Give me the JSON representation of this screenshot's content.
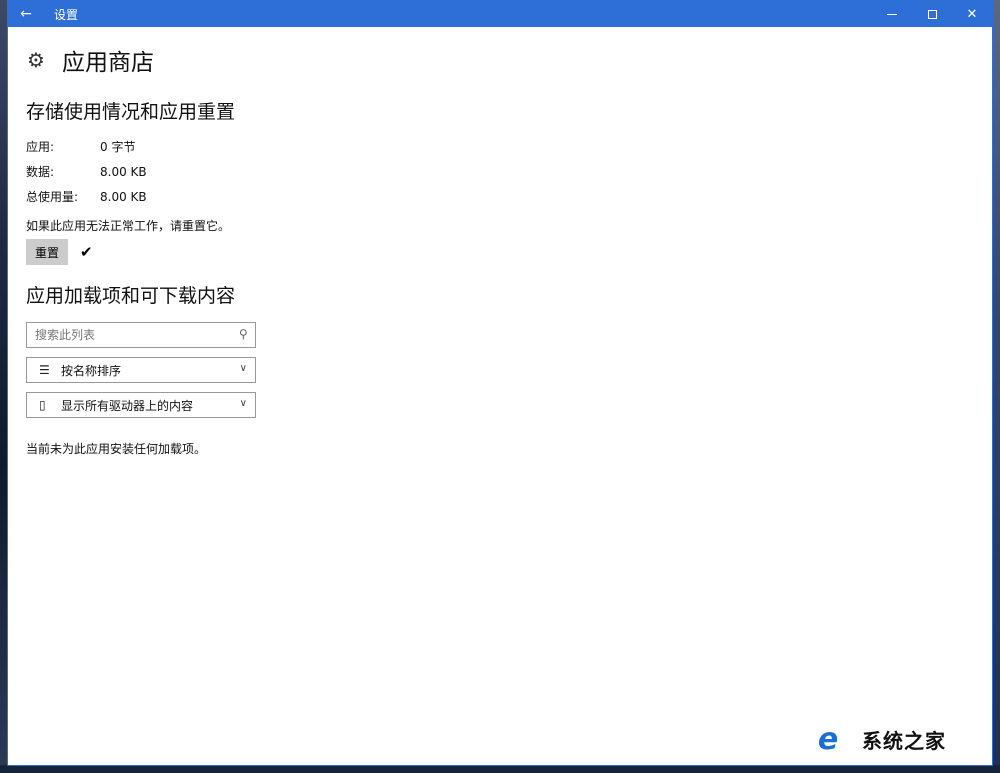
{
  "window": {
    "title": "设置",
    "back_icon": "←",
    "controls": {
      "close_icon": "✕"
    }
  },
  "page": {
    "icon": "⚙",
    "title": "应用商店"
  },
  "storage": {
    "title": "存储使用情况和应用重置",
    "rows": [
      {
        "label": "应用:",
        "value": "0 字节"
      },
      {
        "label": "数据:",
        "value": "8.00 KB"
      },
      {
        "label": "总使用量:",
        "value": "8.00 KB"
      }
    ],
    "reset_hint": "如果此应用无法正常工作，请重置它。",
    "reset_button": "重置",
    "reset_done_icon": "✔"
  },
  "addons": {
    "title": "应用加载项和可下载内容",
    "search": {
      "placeholder": "搜索此列表",
      "value": ""
    },
    "sort_dropdown": {
      "icon": "☰",
      "selected": "按名称排序"
    },
    "drive_dropdown": {
      "icon": "▯",
      "selected": "显示所有驱动器上的内容"
    },
    "chevron_icon": "∨",
    "empty_message": "当前未为此应用安装任何加载项。"
  },
  "watermark": {
    "text": "系统之家"
  },
  "colors": {
    "titlebar": "#2d6fd6",
    "reset_button_bg": "#cccccc",
    "watermark_logo": "#1a6fd0"
  }
}
